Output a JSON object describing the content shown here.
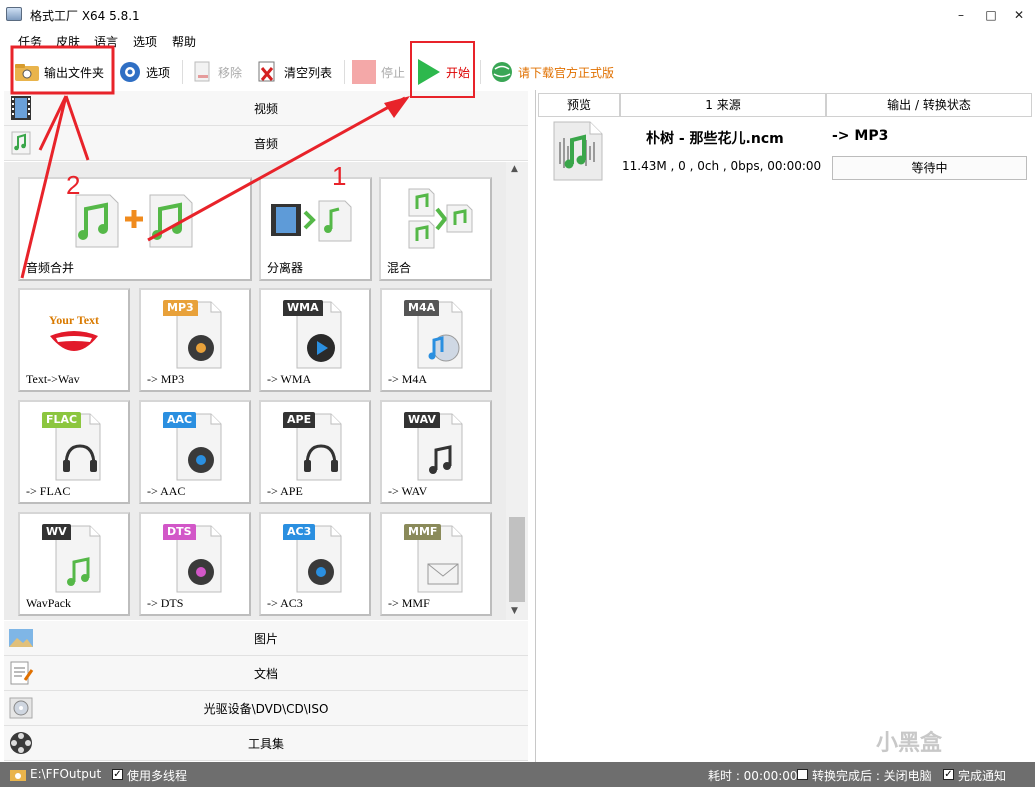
{
  "window": {
    "title": "格式工厂 X64 5.8.1",
    "minimize": "–",
    "maximize": "□",
    "close": "✕"
  },
  "menu": [
    "任务",
    "皮肤",
    "语言",
    "选项",
    "帮助"
  ],
  "toolbar": {
    "output_folder": "输出文件夹",
    "options": "选项",
    "remove": "移除",
    "clear_list": "清空列表",
    "stop": "停止",
    "start": "开始",
    "download": "请下载官方正式版"
  },
  "categories": {
    "video": "视频",
    "audio": "音频",
    "image": "图片",
    "document": "文档",
    "rom": "光驱设备\\DVD\\CD\\ISO",
    "tools": "工具集"
  },
  "tiles_big": [
    {
      "label": "音频合并",
      "icon": "audio-merge-icon"
    },
    {
      "label": "分离器",
      "icon": "splitter-icon"
    },
    {
      "label": "混合",
      "icon": "mix-icon"
    }
  ],
  "tiles": [
    {
      "label": "Text->Wav",
      "badge": "Your Text",
      "icon": "mouth-icon"
    },
    {
      "label": "-> MP3",
      "badge": "MP3",
      "badge_color": "#e8a13a",
      "icon": "speaker-icon"
    },
    {
      "label": "-> WMA",
      "badge": "WMA",
      "badge_color": "#333333",
      "icon": "disc-play-icon"
    },
    {
      "label": "-> M4A",
      "badge": "M4A",
      "badge_color": "#555555",
      "icon": "disc-note-icon"
    },
    {
      "label": "-> FLAC",
      "badge": "FLAC",
      "badge_color": "#8cc63f",
      "icon": "headphones-icon"
    },
    {
      "label": "-> AAC",
      "badge": "AAC",
      "badge_color": "#2a8fe0",
      "icon": "speaker-icon"
    },
    {
      "label": "-> APE",
      "badge": "APE",
      "badge_color": "#333333",
      "icon": "headphones-icon"
    },
    {
      "label": "-> WAV",
      "badge": "WAV",
      "badge_color": "#333333",
      "icon": "note-icon"
    },
    {
      "label": "WavPack",
      "badge": "WV",
      "badge_color": "#333333",
      "icon": "note-icon"
    },
    {
      "label": "-> DTS",
      "badge": "DTS",
      "badge_color": "#d257c8",
      "icon": "speaker-icon"
    },
    {
      "label": "-> AC3",
      "badge": "AC3",
      "badge_color": "#2a8fe0",
      "icon": "speaker-icon"
    },
    {
      "label": "-> MMF",
      "badge": "MMF",
      "badge_color": "#8a8a5a",
      "icon": "envelope-icon"
    }
  ],
  "task_list": {
    "headers": [
      "预览",
      "1 来源",
      "输出 / 转换状态"
    ],
    "rows": [
      {
        "name": "朴树 - 那些花儿.ncm",
        "output": "-> MP3",
        "info": "11.43M , 0 , 0ch , 0bps, 00:00:00",
        "status": "等待中"
      }
    ]
  },
  "statusbar": {
    "output_path": "E:\\FFOutput",
    "multithread": "使用多线程",
    "elapsed": "耗时 : 00:00:00",
    "after_done": "转换完成后 : 关闭电脑",
    "notify": "完成通知"
  },
  "annotations": {
    "step1": "1",
    "step2": "2"
  },
  "watermark": "小黑盒",
  "colors": {
    "annotation_red": "#e8232a",
    "status_gray": "#6e6e6e",
    "play_green": "#2db84d",
    "note_green": "#6cc43c"
  }
}
